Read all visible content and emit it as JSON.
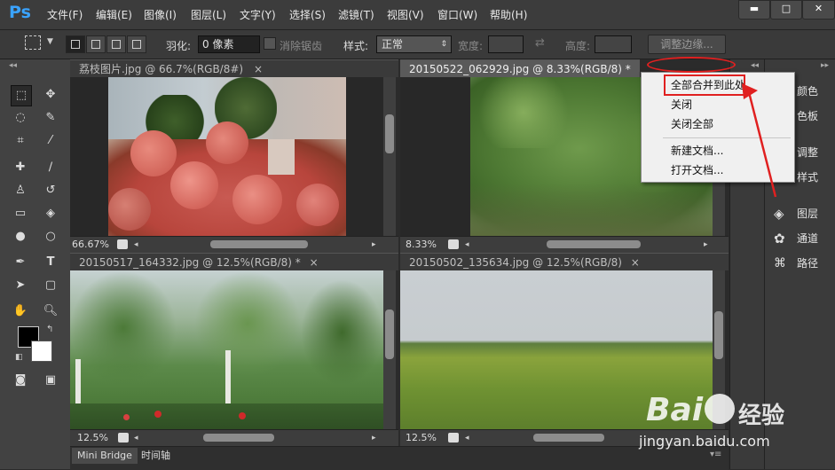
{
  "app": {
    "logo": "Ps"
  },
  "menu": [
    "文件(F)",
    "编辑(E)",
    "图像(I)",
    "图层(L)",
    "文字(Y)",
    "选择(S)",
    "滤镜(T)",
    "视图(V)",
    "窗口(W)",
    "帮助(H)"
  ],
  "window_controls": {
    "minimize": "▬",
    "maximize": "□",
    "close": "✕"
  },
  "options": {
    "feather_label": "羽化:",
    "feather_value": "0 像素",
    "antialias_label": "消除锯齿",
    "style_label": "样式:",
    "style_value": "正常",
    "width_label": "宽度:",
    "height_label": "高度:",
    "refine_button": "调整边缘..."
  },
  "documents": [
    {
      "title": "荔枝图片.jpg @ 66.7%(RGB/8#)",
      "close": "×",
      "zoom": "66.67%"
    },
    {
      "title": "20150522_062929.jpg @ 8.33%(RGB/8) *",
      "close": "×",
      "zoom": "8.33%"
    },
    {
      "title": "20150517_164332.jpg @ 12.5%(RGB/8) *",
      "close": "×",
      "zoom": "12.5%"
    },
    {
      "title": "20150502_135634.jpg @ 12.5%(RGB/8)",
      "close": "×",
      "zoom": "12.5%"
    }
  ],
  "context_menu": {
    "items": [
      "全部合并到此处",
      "关闭",
      "关闭全部",
      "新建文档...",
      "打开文档..."
    ]
  },
  "panels": [
    "颜色",
    "色板",
    "调整",
    "样式",
    "图层",
    "通道",
    "路径"
  ],
  "bottom_tabs": [
    "Mini Bridge",
    "时间轴"
  ],
  "watermark": {
    "brand": "Bai",
    "brand_cn": "经验",
    "url": "jingyan.baidu.com"
  },
  "colors": {
    "accent": "#3aa3ff",
    "highlight": "#e02020",
    "menu_bg": "#f0f0f0"
  }
}
